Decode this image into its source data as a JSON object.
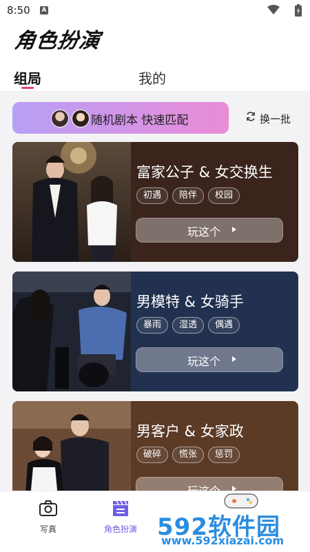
{
  "status_bar": {
    "time": "8:50",
    "notification_icon": "A"
  },
  "app": {
    "title": "角色扮演"
  },
  "tabs": [
    {
      "label": "组局",
      "active": true
    },
    {
      "label": "我的",
      "active": false
    }
  ],
  "match_bar": {
    "label": "随机剧本 快速匹配"
  },
  "refresh": {
    "label": "换一批"
  },
  "cards": [
    {
      "title": "富家公子 & 女交换生",
      "tags": [
        "初遇",
        "陪伴",
        "校园"
      ],
      "button": "玩这个",
      "bg": "#3a241c"
    },
    {
      "title": "男模特 & 女骑手",
      "tags": [
        "暴雨",
        "湿透",
        "偶遇"
      ],
      "button": "玩这个",
      "bg": "#223150"
    },
    {
      "title": "男客户 & 女家政",
      "tags": [
        "破碎",
        "慌张",
        "惩罚"
      ],
      "button": "玩这个",
      "bg": "#5b3a26"
    }
  ],
  "bottom_nav": [
    {
      "label": "写真",
      "icon": "camera-icon"
    },
    {
      "label": "角色扮演",
      "icon": "clapperboard-icon"
    }
  ],
  "watermark": {
    "main": "592软件园",
    "url": "www.592xiazai.com"
  },
  "colors": {
    "accent": "#e8416e",
    "nav_active": "#6d5ee8",
    "watermark": "#2b8de0"
  }
}
